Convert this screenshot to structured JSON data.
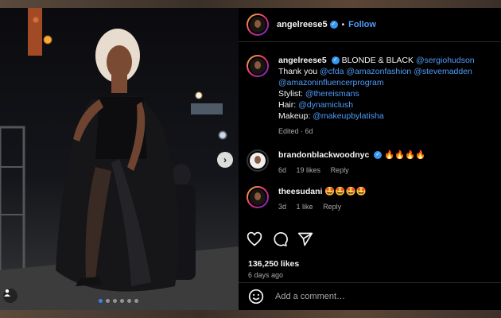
{
  "header": {
    "username": "angelreese5",
    "separator": "•",
    "follow_label": "Follow"
  },
  "caption": {
    "username": "angelreese5",
    "line1": "BLONDE & BLACK",
    "mention1": "@sergiohudson",
    "thanks": "Thank you",
    "m_cfda": "@cfda",
    "m_amazonfashion": "@amazonfashion",
    "m_stevemadden": "@stevemadden",
    "m_amazoninfluencer": "@amazoninfluencerprogram",
    "stylist_label": "Stylist:",
    "m_stylist": "@thereismans",
    "hair_label": "Hair:",
    "m_hair": "@dynamiclush",
    "makeup_label": "Makeup:",
    "m_makeup": "@makeupbylatisha",
    "meta": "Edited · 6d"
  },
  "comments": [
    {
      "username": "brandonblackwoodnyc",
      "text": "🔥🔥🔥🔥",
      "time": "6d",
      "likes": "19 likes",
      "reply": "Reply"
    },
    {
      "username": "theesudani",
      "text": "🤩🤩🤩🤩",
      "time": "3d",
      "likes": "1 like",
      "reply": "Reply"
    }
  ],
  "likes_count": "136,250 likes",
  "posted": "6 days ago",
  "add_comment_placeholder": "Add a comment…",
  "carousel": {
    "total": 6,
    "active": 1
  },
  "icons": [
    "heart-icon",
    "comment-icon",
    "share-icon",
    "emoji-icon",
    "user-tag-icon",
    "chevron-right-icon",
    "verified-icon"
  ],
  "colors": {
    "accent": "#4f9cf9",
    "panel_bg": "#000000",
    "muted": "#a8a8a8"
  }
}
